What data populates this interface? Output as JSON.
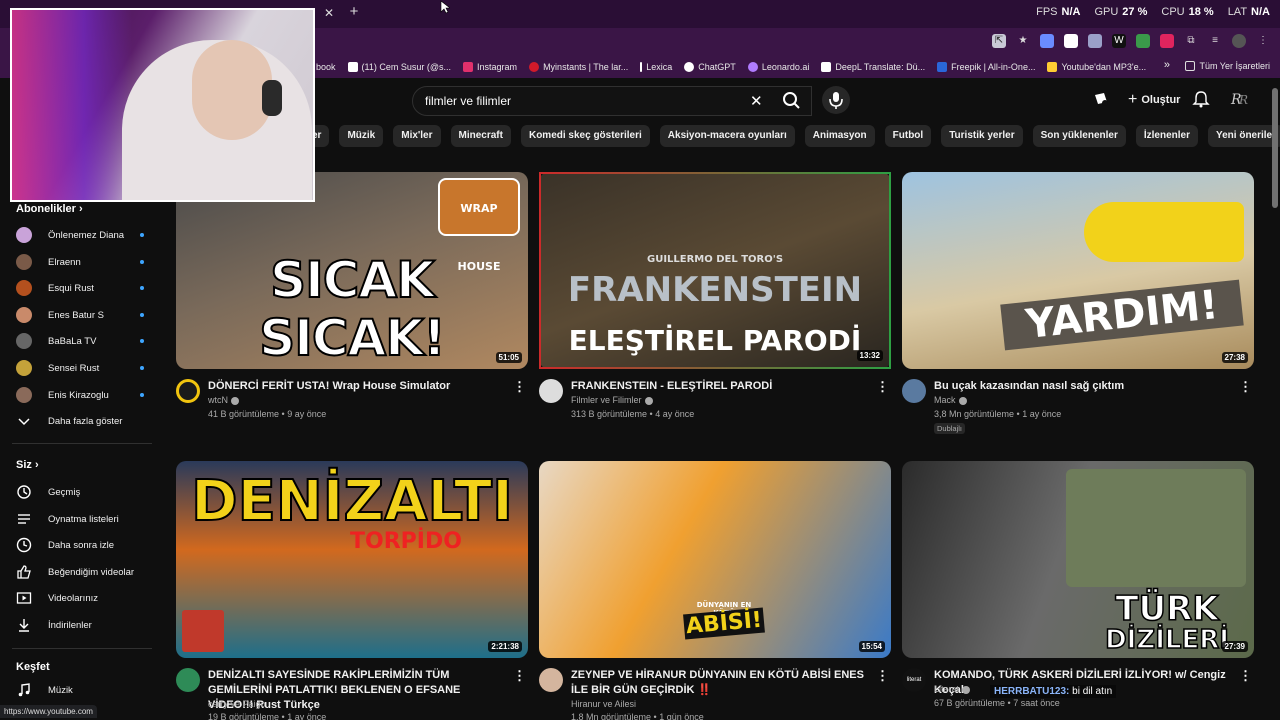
{
  "stream_stats": [
    {
      "label": "FPS",
      "value": "N/A"
    },
    {
      "label": "GPU",
      "value": "27 %"
    },
    {
      "label": "CPU",
      "value": "18 %"
    },
    {
      "label": "LAT",
      "value": "N/A"
    }
  ],
  "bookmarks": {
    "items": [
      {
        "label": "book",
        "color": "#1877f2"
      },
      {
        "label": "(11) Cem Susur (@s...",
        "color": "#ffffff"
      },
      {
        "label": "Instagram",
        "color": "#e1306c"
      },
      {
        "label": "Myinstants | The lar...",
        "color": "#d11a2a"
      },
      {
        "label": "Lexica",
        "color": "#ffffff"
      },
      {
        "label": "ChatGPT",
        "color": "#ffffff"
      },
      {
        "label": "Leonardo.ai",
        "color": "#b07cff"
      },
      {
        "label": "DeepL Translate: Dü...",
        "color": "#0f2b46"
      },
      {
        "label": "Freepik | All-in-One...",
        "color": "#2a66d9"
      },
      {
        "label": "Youtube'dan MP3'e...",
        "color": "#ffcc33"
      }
    ],
    "all_label": "Tüm Yer İşaretleri"
  },
  "search": {
    "value": "filmler ve filimler"
  },
  "header": {
    "create_label": "Oluştur"
  },
  "chips": [
    "er",
    "Müzik",
    "Mix'ler",
    "Minecraft",
    "Komedi skeç gösterileri",
    "Aksiyon-macera oyunları",
    "Animasyon",
    "Futbol",
    "Turistik yerler",
    "Son yüklenenler",
    "İzlenenler",
    "Yeni öneriler"
  ],
  "sidebar": {
    "subs_heading": "Abonelikler",
    "subs": [
      {
        "label": "Önlenemez Diana",
        "color": "#c9a3d9"
      },
      {
        "label": "Elraenn",
        "color": "#7a5a48"
      },
      {
        "label": "Esqui Rust",
        "color": "#b4501e"
      },
      {
        "label": "Enes Batur S",
        "color": "#c98a6a"
      },
      {
        "label": "BaBaLa TV",
        "color": "#666666"
      },
      {
        "label": "Sensei Rust",
        "color": "#c4a23a"
      },
      {
        "label": "Enis Kirazoglu",
        "color": "#8a6a5a"
      }
    ],
    "show_more": "Daha fazla göster",
    "you_heading": "Siz",
    "you_items": [
      {
        "label": "Geçmiş",
        "icon": "history-icon"
      },
      {
        "label": "Oynatma listeleri",
        "icon": "playlists-icon"
      },
      {
        "label": "Daha sonra izle",
        "icon": "watch-later-icon"
      },
      {
        "label": "Beğendiğim videolar",
        "icon": "liked-icon"
      },
      {
        "label": "Videolarınız",
        "icon": "your-videos-icon"
      },
      {
        "label": "İndirilenler",
        "icon": "downloads-icon"
      }
    ],
    "explore_heading": "Keşfet",
    "explore_items": [
      {
        "label": "Müzik",
        "icon": "music-icon"
      }
    ]
  },
  "videos": [
    {
      "title": "DÖNERCİ FERİT USTA! Wrap House Simulator",
      "channel": "wtcN",
      "stats": "41 B görüntüleme • 9 ay önce",
      "duration": "51:05",
      "thumb_text": "SICAK SICAK!",
      "thumb_logo": "WRAP HOUSE",
      "chan_color": "#f1c40f"
    },
    {
      "title": "FRANKENSTEIN - ELEŞTİREL PARODİ",
      "channel": "Filmler ve Filimler",
      "stats": "313 B görüntüleme • 4 ay önce",
      "duration": "13:32",
      "thumb_text": "ELEŞTİREL PARODİ",
      "thumb_sub": "FRANKENSTEIN",
      "thumb_pre": "GUILLERMO DEL TORO'S",
      "chan_color": "#dddddd"
    },
    {
      "title": "Bu uçak kazasından nasıl sağ çıktım",
      "channel": "Mack",
      "stats": "3,8 Mn görüntüleme • 1 ay önce",
      "duration": "27:38",
      "thumb_text": "YARDIM!",
      "badge": "Dublajlı",
      "chan_color": "#5a7aa0"
    },
    {
      "title": "DENİZALTI SAYESİNDE RAKİPLERİMİZİN TÜM GEMİLERİNİ PATLATTIK! BEKLENEN O EFSANE VİDEO!!! Rust Türkçe",
      "channel": "carry ve Paigo",
      "stats": "19 B görüntüleme • 1 ay önce",
      "duration": "2:21:38",
      "thumb_text": "DENİZALTI",
      "thumb_sub": "TORPİDO",
      "chan_color": "#2e8b57"
    },
    {
      "title": "ZEYNEP VE HİRANUR DÜNYANIN EN KÖTÜ ABİSİ ENES İLE BİR GÜN GEÇİRDİK ‼️",
      "channel": "Hiranur ve Ailesi",
      "stats": "1,8 Mn görüntüleme • 1 gün önce",
      "duration": "15:54",
      "thumb_text": "ABİSİ!",
      "thumb_sub": "DÜNYANIN EN KÖTÜ",
      "chan_color": "#d4b59e"
    },
    {
      "title": "KOMANDO, TÜRK ASKERİ DİZİLERİ İZLİYOR! w/ Cengiz Koçak",
      "channel": "Literat",
      "stats": "67 B görüntüleme • 7 saat önce",
      "duration": "27:39",
      "thumb_text": "TÜRK",
      "thumb_sub": "DİZİLERİ",
      "chan_color": "#ffffff",
      "chan_text": "literat"
    }
  ],
  "chat": {
    "user": "HERRBATU123:",
    "message": "bi dil atın"
  },
  "status_url": "https://www.youtube.com",
  "colors": {
    "bg": "#0f0f0f",
    "chip": "#272727",
    "accent_red": "#ff0000",
    "browser_purple": "#3a1546"
  }
}
